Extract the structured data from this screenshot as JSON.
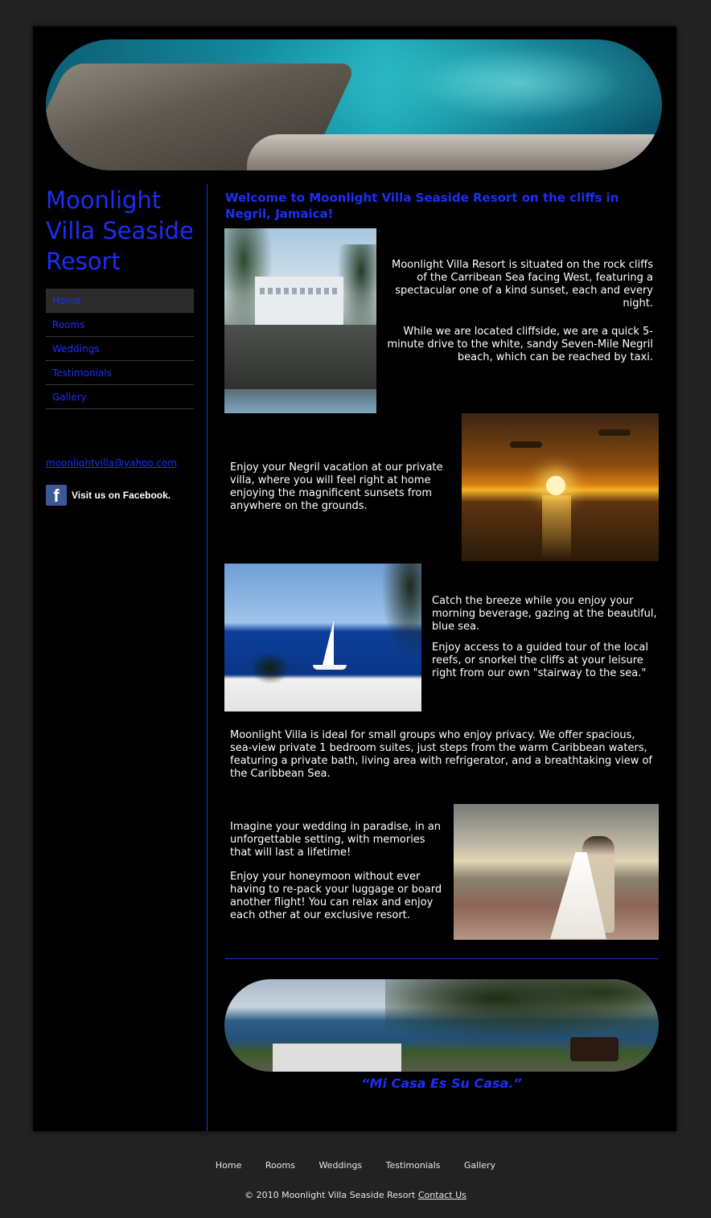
{
  "site": {
    "title": "Moonlight Villa Seaside Resort",
    "email": "moonlightvilla@yahoo.com",
    "facebook_text": "Visit us on Facebook.",
    "facebook_letter": "f"
  },
  "nav": {
    "items": [
      {
        "label": "Home",
        "active": true
      },
      {
        "label": "Rooms"
      },
      {
        "label": "Weddings"
      },
      {
        "label": "Testimonials"
      },
      {
        "label": "Gallery"
      }
    ]
  },
  "main": {
    "welcome": "Welcome to Moonlight Villa Seaside Resort on the cliffs in Negril, Jamaica!",
    "villa_p1": "Moonlight Villa Resort is situated on the rock cliffs of the Carribean Sea facing West, featuring a spectacular one of a kind sunset, each and every night.",
    "villa_p2": "While we are located cliffside, we are a quick 5-minute drive to the white, sandy Seven-Mile Negril beach, which can be reached by taxi.",
    "sunset_p": "Enjoy your Negril vacation at our private villa, where you will feel right at home enjoying the magnificent sunsets from anywhere on the grounds.",
    "breeze_p1": "Catch the breeze while you enjoy your morning beverage, gazing at the beautiful, blue sea.",
    "breeze_p2": "Enjoy access to a guided tour of the local reefs, or snorkel the cliffs at your leisure right from our own \"stairway to the sea.\"",
    "groups_p": "Moonlight Villa is ideal for small groups who enjoy privacy.  We offer spacious, sea-view private 1 bedroom suites, just steps from the warm Caribbean waters, featuring a private bath, living area with refrigerator, and a breathtaking view of the Caribbean Sea.",
    "wedding_p1": "Imagine your wedding in paradise, in an unforgettable setting, with memories that will last a lifetime!",
    "wedding_p2": "Enjoy your honeymoon without ever having to re-pack your luggage or board another flight!  You can relax and enjoy each other at our exclusive resort.",
    "motto": "“Mi Casa Es Su Casa.”"
  },
  "footer": {
    "nav": [
      "Home",
      "Rooms",
      "Weddings",
      "Testimonials",
      "Gallery"
    ],
    "copyright": "© 2010 Moonlight Villa Seaside Resort",
    "contact_label": "Contact Us"
  },
  "colors": {
    "accent": "#1b2ff5",
    "page_bg": "#222222",
    "content_bg": "#000000"
  }
}
